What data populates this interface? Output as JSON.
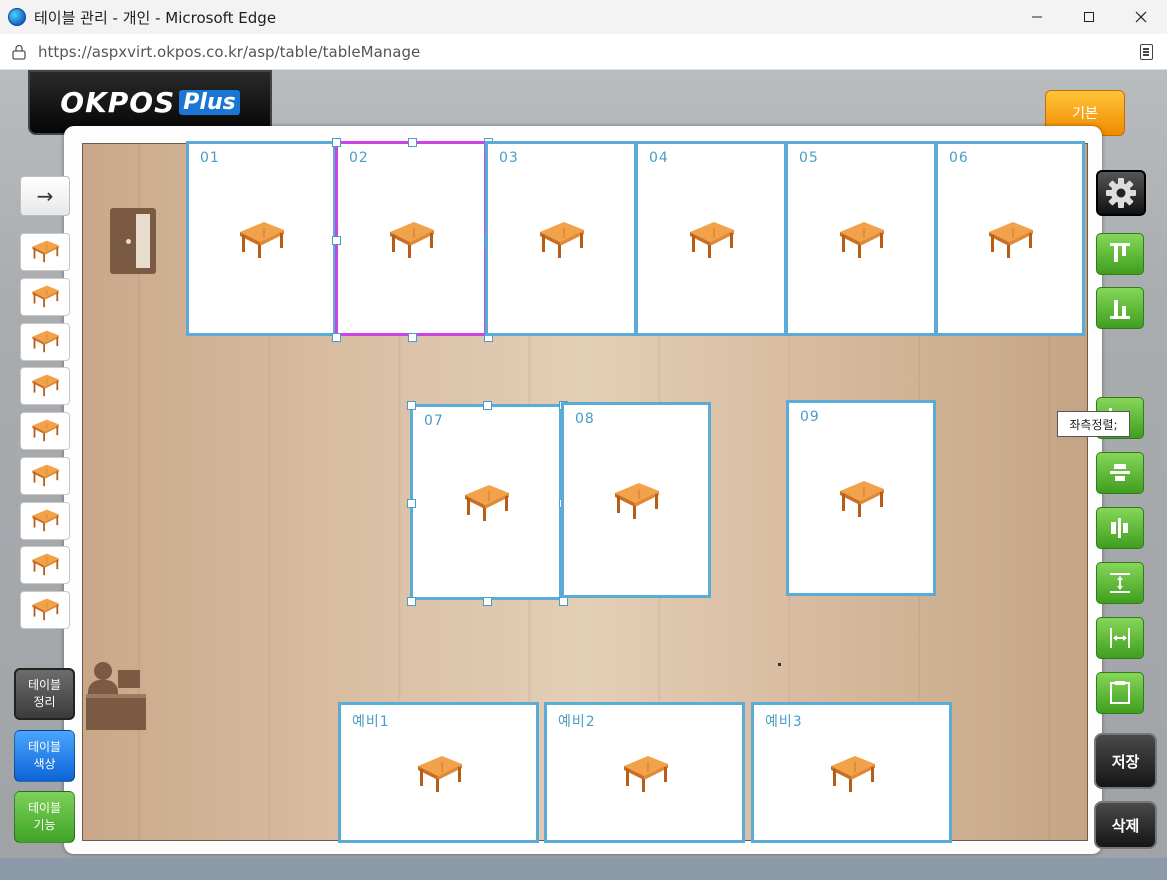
{
  "window": {
    "title": "테이블 관리 - 개인 - Microsoft Edge",
    "url": "https://aspxvirt.okpos.co.kr/asp/table/tableManage",
    "controls": [
      "minimize",
      "maximize",
      "close"
    ]
  },
  "logo": {
    "text": "OKPOS",
    "plus": "Plus"
  },
  "header": {
    "basic_button": "기본"
  },
  "left_panel": {
    "arrow": "→",
    "palette": [
      "table-square-small",
      "table-4-seat",
      "table-6-seat",
      "table-8-seat",
      "table-round-2",
      "table-round-4",
      "table-round-5",
      "table-round-6",
      "table-round-8"
    ],
    "buttons": {
      "arrange": "테이블\n정리",
      "color": "테이블\n색상",
      "function": "테이블\n기능"
    }
  },
  "tables": [
    {
      "label": "01",
      "selected": false
    },
    {
      "label": "02",
      "selected": true
    },
    {
      "label": "03",
      "selected": false
    },
    {
      "label": "04",
      "selected": false
    },
    {
      "label": "05",
      "selected": false
    },
    {
      "label": "06",
      "selected": false
    },
    {
      "label": "07",
      "selected": true
    },
    {
      "label": "08",
      "selected": false
    },
    {
      "label": "09",
      "selected": false
    },
    {
      "label": "예비1",
      "selected": false
    },
    {
      "label": "예비2",
      "selected": false
    },
    {
      "label": "예비3",
      "selected": false
    }
  ],
  "right_toolbar": {
    "tools": [
      "gear-icon",
      "align-top-icon",
      "align-bottom-icon",
      "align-left-icon",
      "align-center-vertical-icon",
      "align-center-horizontal-icon",
      "distribute-vertical-icon",
      "distribute-horizontal-icon",
      "same-size-icon"
    ],
    "tooltip": "좌측정렬;",
    "save": "저장",
    "delete": "삭제"
  },
  "colors": {
    "table_border": "#5aabd6",
    "selected_border": "#cc44e6",
    "label": "#4a9cc9"
  }
}
